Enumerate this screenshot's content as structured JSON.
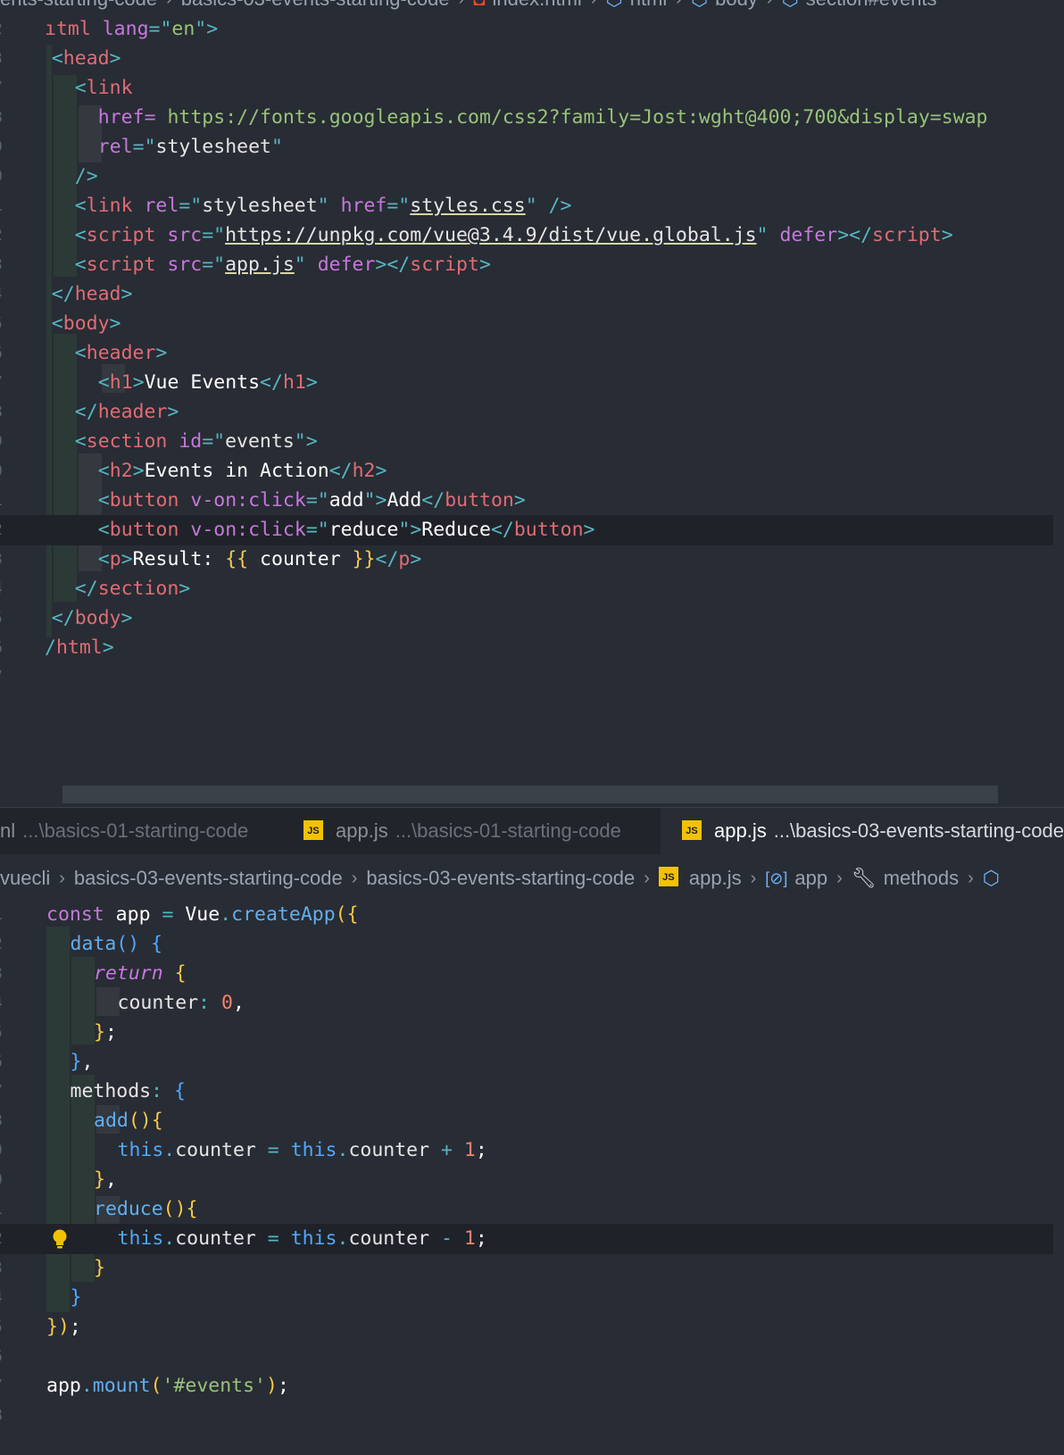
{
  "top_breadcrumb": {
    "items": [
      "ents-starting-code",
      "basics-03-events-starting-code",
      "index.html",
      "html",
      "body",
      "section#events"
    ]
  },
  "html_editor": {
    "line_numbers": [
      "2",
      "3",
      "7",
      "8",
      "9",
      "0",
      "1",
      "2",
      "3",
      "4",
      "5",
      "6",
      "7",
      "8",
      "9",
      "0",
      "1",
      "2",
      "3",
      "4",
      "5",
      "6",
      "7"
    ],
    "lines": [
      [
        [
          "c-tag",
          "ıtml"
        ],
        [
          "c-txt",
          " "
        ],
        [
          "c-att",
          "lang"
        ],
        [
          "c-pun",
          "=\""
        ],
        [
          "c-str",
          "en"
        ],
        [
          "c-pun",
          "\">"
        ]
      ],
      [
        [
          "c-pun",
          "<"
        ],
        [
          "c-tag",
          "head"
        ],
        [
          "c-pun",
          ">"
        ]
      ],
      [
        [
          "c-pun",
          "<"
        ],
        [
          "c-tag",
          "link"
        ]
      ],
      [
        [
          "c-att",
          "href="
        ],
        [
          "c-str",
          " https://fonts.googleapis.com/css2?family=Jost:wght@400;700&display=swap"
        ]
      ],
      [
        [
          "c-att",
          "rel"
        ],
        [
          "c-pun",
          "=\""
        ],
        [
          "c-strb",
          "stylesheet"
        ],
        [
          "c-pun",
          "\""
        ]
      ],
      [
        [
          "c-pun",
          "/>"
        ]
      ],
      [
        [
          "c-pun",
          "<"
        ],
        [
          "c-tag",
          "link"
        ],
        [
          "c-txt",
          " "
        ],
        [
          "c-att",
          "rel"
        ],
        [
          "c-pun",
          "=\""
        ],
        [
          "c-strb",
          "stylesheet"
        ],
        [
          "c-pun",
          "\""
        ],
        [
          "c-txt",
          " "
        ],
        [
          "c-att",
          "href"
        ],
        [
          "c-pun",
          "=\""
        ],
        [
          "c-lnk",
          "styles.css"
        ],
        [
          "c-pun",
          "\""
        ],
        [
          "c-txt",
          " "
        ],
        [
          "c-pun",
          "/>"
        ]
      ],
      [
        [
          "c-pun",
          "<"
        ],
        [
          "c-tag",
          "script"
        ],
        [
          "c-txt",
          " "
        ],
        [
          "c-att",
          "src"
        ],
        [
          "c-pun",
          "=\""
        ],
        [
          "c-lnk",
          "https://unpkg.com/vue@3.4.9/dist/vue.global.js"
        ],
        [
          "c-pun",
          "\""
        ],
        [
          "c-txt",
          " "
        ],
        [
          "c-att",
          "defer"
        ],
        [
          "c-pun",
          "></"
        ],
        [
          "c-tag",
          "script"
        ],
        [
          "c-pun",
          ">"
        ]
      ],
      [
        [
          "c-pun",
          "<"
        ],
        [
          "c-tag",
          "script"
        ],
        [
          "c-txt",
          " "
        ],
        [
          "c-att",
          "src"
        ],
        [
          "c-pun",
          "=\""
        ],
        [
          "c-lnk",
          "app.js"
        ],
        [
          "c-pun",
          "\""
        ],
        [
          "c-txt",
          " "
        ],
        [
          "c-att",
          "defer"
        ],
        [
          "c-pun",
          "></"
        ],
        [
          "c-tag",
          "script"
        ],
        [
          "c-pun",
          ">"
        ]
      ],
      [
        [
          "c-pun",
          "</"
        ],
        [
          "c-tag",
          "head"
        ],
        [
          "c-pun",
          ">"
        ]
      ],
      [
        [
          "c-pun",
          "<"
        ],
        [
          "c-tag",
          "body"
        ],
        [
          "c-pun",
          ">"
        ]
      ],
      [
        [
          "c-pun",
          "<"
        ],
        [
          "c-tag",
          "header"
        ],
        [
          "c-pun",
          ">"
        ]
      ],
      [
        [
          "c-pun",
          "<"
        ],
        [
          "c-tag",
          "h1"
        ],
        [
          "c-pun",
          ">"
        ],
        [
          "c-txt",
          "Vue Events"
        ],
        [
          "c-pun",
          "</"
        ],
        [
          "c-tag",
          "h1"
        ],
        [
          "c-pun",
          ">"
        ]
      ],
      [
        [
          "c-pun",
          "</"
        ],
        [
          "c-tag",
          "header"
        ],
        [
          "c-pun",
          ">"
        ]
      ],
      [
        [
          "c-pun",
          "<"
        ],
        [
          "c-tag",
          "section"
        ],
        [
          "c-txt",
          " "
        ],
        [
          "c-att",
          "id"
        ],
        [
          "c-pun",
          "=\""
        ],
        [
          "c-strb",
          "events"
        ],
        [
          "c-pun",
          "\">"
        ]
      ],
      [
        [
          "c-pun",
          "<"
        ],
        [
          "c-tag",
          "h2"
        ],
        [
          "c-pun",
          ">"
        ],
        [
          "c-txt",
          "Events in Action"
        ],
        [
          "c-pun",
          "</"
        ],
        [
          "c-tag",
          "h2"
        ],
        [
          "c-pun",
          ">"
        ]
      ],
      [
        [
          "c-pun",
          "<"
        ],
        [
          "c-tag",
          "button"
        ],
        [
          "c-txt",
          " "
        ],
        [
          "c-att",
          "v-on:click"
        ],
        [
          "c-pun",
          "=\""
        ],
        [
          "c-txt",
          "add"
        ],
        [
          "c-pun",
          "\">"
        ],
        [
          "c-txt",
          "Add"
        ],
        [
          "c-pun",
          "</"
        ],
        [
          "c-tag",
          "button"
        ],
        [
          "c-pun",
          ">"
        ]
      ],
      [
        [
          "c-pun",
          "<"
        ],
        [
          "c-tag",
          "button"
        ],
        [
          "c-txt",
          " "
        ],
        [
          "c-att",
          "v-on:click"
        ],
        [
          "c-pun",
          "=\""
        ],
        [
          "c-txt",
          "reduce"
        ],
        [
          "c-pun",
          "\">"
        ],
        [
          "c-txt",
          "Reduce"
        ],
        [
          "c-pun",
          "</"
        ],
        [
          "c-tag",
          "button"
        ],
        [
          "c-pun",
          ">"
        ]
      ],
      [
        [
          "c-pun",
          "<"
        ],
        [
          "c-tag",
          "p"
        ],
        [
          "c-pun",
          ">"
        ],
        [
          "c-txt",
          "Result: "
        ],
        [
          "c-yel",
          "{{"
        ],
        [
          "c-txt",
          " counter "
        ],
        [
          "c-yel",
          "}}"
        ],
        [
          "c-pun",
          "</"
        ],
        [
          "c-tag",
          "p"
        ],
        [
          "c-pun",
          ">"
        ]
      ],
      [
        [
          "c-pun",
          "</"
        ],
        [
          "c-tag",
          "section"
        ],
        [
          "c-pun",
          ">"
        ]
      ],
      [
        [
          "c-pun",
          "</"
        ],
        [
          "c-tag",
          "body"
        ],
        [
          "c-pun",
          ">"
        ]
      ],
      [
        [
          "c-pun",
          "/"
        ],
        [
          "c-tag",
          "html"
        ],
        [
          "c-pun",
          ">"
        ]
      ],
      []
    ]
  },
  "tabs": [
    {
      "name": "nl",
      "path": "...\\basics-01-starting-code",
      "icon": "none",
      "active": false
    },
    {
      "name": "app.js",
      "path": "...\\basics-01-starting-code",
      "icon": "js-icon",
      "active": false
    },
    {
      "name": "app.js",
      "path": "...\\basics-03-events-starting-code",
      "icon": "js-icon",
      "active": true
    }
  ],
  "bottom_breadcrumb": {
    "items": [
      "vuecli",
      "basics-03-events-starting-code",
      "basics-03-events-starting-code",
      "app.js",
      "app",
      "methods"
    ]
  },
  "js_editor": {
    "line_numbers": [
      "1",
      "2",
      "3",
      "4",
      "5",
      "6",
      "7",
      "8",
      "9",
      "0",
      "1",
      "2",
      "3",
      "4",
      "5",
      "6",
      "7",
      "8"
    ],
    "lines": [
      [
        [
          "c-kw",
          "const"
        ],
        [
          "c-var",
          " app "
        ],
        [
          "c-op",
          "="
        ],
        [
          "c-var",
          " Vue"
        ],
        [
          "c-op",
          "."
        ],
        [
          "c-fn",
          "createApp"
        ],
        [
          "c-yel",
          "({"
        ]
      ],
      [
        [
          "c-fn",
          "data"
        ],
        [
          "c-blu",
          "()"
        ],
        [
          "c-var",
          " "
        ],
        [
          "c-blu",
          "{"
        ]
      ],
      [
        [
          "c-kwi",
          "return"
        ],
        [
          "c-var",
          " "
        ],
        [
          "c-yel",
          "{"
        ]
      ],
      [
        [
          "c-prop",
          "counter"
        ],
        [
          "c-op",
          ":"
        ],
        [
          "c-var",
          " "
        ],
        [
          "c-num",
          "0"
        ],
        [
          "c-var",
          ","
        ]
      ],
      [
        [
          "c-yel",
          "}"
        ],
        [
          "c-var",
          ";"
        ]
      ],
      [
        [
          "c-blu",
          "}"
        ],
        [
          "c-var",
          ","
        ]
      ],
      [
        [
          "c-prop",
          "methods"
        ],
        [
          "c-op",
          ":"
        ],
        [
          "c-var",
          " "
        ],
        [
          "c-blu",
          "{"
        ]
      ],
      [
        [
          "c-fn",
          "add"
        ],
        [
          "c-yel",
          "(){"
        ]
      ],
      [
        [
          "c-blu",
          "this"
        ],
        [
          "c-op",
          "."
        ],
        [
          "c-prop",
          "counter"
        ],
        [
          "c-var",
          " "
        ],
        [
          "c-op",
          "="
        ],
        [
          "c-var",
          " "
        ],
        [
          "c-blu",
          "this"
        ],
        [
          "c-op",
          "."
        ],
        [
          "c-prop",
          "counter"
        ],
        [
          "c-var",
          " "
        ],
        [
          "c-op",
          "+"
        ],
        [
          "c-var",
          " "
        ],
        [
          "c-num",
          "1"
        ],
        [
          "c-var",
          ";"
        ]
      ],
      [
        [
          "c-yel",
          "}"
        ],
        [
          "c-var",
          ","
        ]
      ],
      [
        [
          "c-fn",
          "reduce"
        ],
        [
          "c-yel",
          "(){"
        ]
      ],
      [
        [
          "c-blu",
          "this"
        ],
        [
          "c-op",
          "."
        ],
        [
          "c-prop",
          "counter"
        ],
        [
          "c-var",
          " "
        ],
        [
          "c-op",
          "="
        ],
        [
          "c-var",
          " "
        ],
        [
          "c-blu",
          "this"
        ],
        [
          "c-op",
          "."
        ],
        [
          "c-prop",
          "counter"
        ],
        [
          "c-var",
          " "
        ],
        [
          "c-op",
          "-"
        ],
        [
          "c-var",
          " "
        ],
        [
          "c-num",
          "1"
        ],
        [
          "c-var",
          ";"
        ]
      ],
      [
        [
          "c-yel",
          "}"
        ]
      ],
      [
        [
          "c-blu",
          "}"
        ]
      ],
      [
        [
          "c-yel",
          "})"
        ],
        [
          "c-var",
          ";"
        ]
      ],
      [],
      [
        [
          "c-var",
          "app"
        ],
        [
          "c-op",
          "."
        ],
        [
          "c-fn",
          "mount"
        ],
        [
          "c-yel",
          "("
        ],
        [
          "c-sq",
          "'#events'"
        ],
        [
          "c-yel",
          ")"
        ],
        [
          "c-var",
          ";"
        ]
      ],
      []
    ]
  },
  "colors": {
    "background": "#282c34",
    "tabbar": "#21252b",
    "js_icon": "#f2c200",
    "lightbulb": "#f2c200"
  }
}
